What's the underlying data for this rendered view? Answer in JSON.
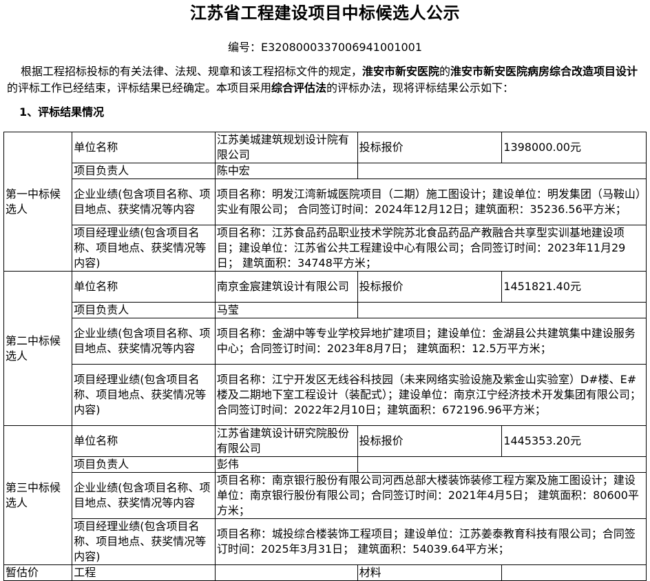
{
  "title": "江苏省工程建设项目中标候选人公示",
  "code_label": "编号：",
  "code_value": "E3208000337006941001001",
  "intro": {
    "p1": "根据工程招标投标的有关法律、法规、规章和该工程招标文件的规定，",
    "org": "淮安市新安医院",
    "p2": "的",
    "project": "淮安市新安医院病房综合改造项目设计",
    "p3": "的评标工作已经结束，评标结果已经确定。本项目采用",
    "method": "综合评估法",
    "p4": "的评标办法，现将评标结果公示如下："
  },
  "section_title": "1、评标结果情况",
  "labels": {
    "unit": "单位名称",
    "bid_price": "投标报价",
    "leader": "项目负责人",
    "company_perf": "企业业绩(包含项目名称、项目地点、获奖情况等内容",
    "manager_perf": "项目经理业绩(包含项目名称、项目地点、获奖情况等内容)"
  },
  "candidates": [
    {
      "rank": "第一中标候选人",
      "unit": "江苏美城建筑规划设计院有限公司",
      "bid": "1398000.00元",
      "leader": "陈中宏",
      "company_perf": "项目名称：明发江湾新城医院项目（二期）施工图设计；建设单位：明发集团（马鞍山）实业有限公司； 合同签订时间：2024年12月12日；建筑面积：35236.56平方米；",
      "manager_perf": "项目名称：江苏食品药品职业技术学院苏北食品药品产教融合共享型实训基地建设项目；建设单位：江苏省公共工程建设中心有限公司；合同签订时间：2023年11月29日； 建筑面积：34748平方米；"
    },
    {
      "rank": "第二中标候选人",
      "unit": "南京金宸建筑设计有限公司",
      "bid": "1451821.40元",
      "leader": "马莹",
      "company_perf": "项目名称：金湖中等专业学校异地扩建项目；建设单位：金湖县公共建筑集中建设服务中心；合同签订时间：2023年8月7日； 建筑面积：12.5万平方米；",
      "manager_perf": "项目名称：江宁开发区无线谷科技园（未来网络实验设施及紫金山实验室）D#楼、E#楼及二期地下室工程设计（装配式）；建设单位：南京江宁经济技术开发集团有限公司；合同签订时间：2022年2月10日；建筑面积：672196.96平方米；"
    },
    {
      "rank": "第三中标候选人",
      "unit": "江苏省建筑设计研究院股份有限公司",
      "bid": "1445353.20元",
      "leader": "彭伟",
      "company_perf": "项目名称：南京银行股份有限公司河西总部大楼装饰装修工程方案及施工图设计；建设单位：南京银行股份有限公司；合同签订时间：2021年4月5日； 建筑面积：80600平方米；",
      "manager_perf": "项目名称：城投综合楼装饰工程项目；建设单位：江苏姜泰教育科技有限公司；合同签订时间：2025年3月31日； 建筑面积：54039.64平方米；"
    }
  ],
  "last_row": {
    "col1": "暂估价",
    "col2": "工程",
    "col4": "材料"
  }
}
